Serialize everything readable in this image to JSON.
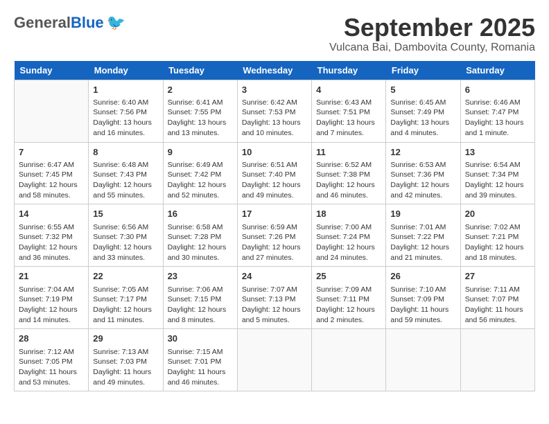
{
  "header": {
    "logo_general": "General",
    "logo_blue": "Blue",
    "month_year": "September 2025",
    "location": "Vulcana Bai, Dambovita County, Romania"
  },
  "days_of_week": [
    "Sunday",
    "Monday",
    "Tuesday",
    "Wednesday",
    "Thursday",
    "Friday",
    "Saturday"
  ],
  "weeks": [
    [
      {
        "day": "",
        "empty": true
      },
      {
        "day": "1",
        "sunrise": "6:40 AM",
        "sunset": "7:56 PM",
        "daylight": "13 hours and 16 minutes."
      },
      {
        "day": "2",
        "sunrise": "6:41 AM",
        "sunset": "7:55 PM",
        "daylight": "13 hours and 13 minutes."
      },
      {
        "day": "3",
        "sunrise": "6:42 AM",
        "sunset": "7:53 PM",
        "daylight": "13 hours and 10 minutes."
      },
      {
        "day": "4",
        "sunrise": "6:43 AM",
        "sunset": "7:51 PM",
        "daylight": "13 hours and 7 minutes."
      },
      {
        "day": "5",
        "sunrise": "6:45 AM",
        "sunset": "7:49 PM",
        "daylight": "13 hours and 4 minutes."
      },
      {
        "day": "6",
        "sunrise": "6:46 AM",
        "sunset": "7:47 PM",
        "daylight": "13 hours and 1 minute."
      }
    ],
    [
      {
        "day": "7",
        "sunrise": "6:47 AM",
        "sunset": "7:45 PM",
        "daylight": "12 hours and 58 minutes."
      },
      {
        "day": "8",
        "sunrise": "6:48 AM",
        "sunset": "7:43 PM",
        "daylight": "12 hours and 55 minutes."
      },
      {
        "day": "9",
        "sunrise": "6:49 AM",
        "sunset": "7:42 PM",
        "daylight": "12 hours and 52 minutes."
      },
      {
        "day": "10",
        "sunrise": "6:51 AM",
        "sunset": "7:40 PM",
        "daylight": "12 hours and 49 minutes."
      },
      {
        "day": "11",
        "sunrise": "6:52 AM",
        "sunset": "7:38 PM",
        "daylight": "12 hours and 46 minutes."
      },
      {
        "day": "12",
        "sunrise": "6:53 AM",
        "sunset": "7:36 PM",
        "daylight": "12 hours and 42 minutes."
      },
      {
        "day": "13",
        "sunrise": "6:54 AM",
        "sunset": "7:34 PM",
        "daylight": "12 hours and 39 minutes."
      }
    ],
    [
      {
        "day": "14",
        "sunrise": "6:55 AM",
        "sunset": "7:32 PM",
        "daylight": "12 hours and 36 minutes."
      },
      {
        "day": "15",
        "sunrise": "6:56 AM",
        "sunset": "7:30 PM",
        "daylight": "12 hours and 33 minutes."
      },
      {
        "day": "16",
        "sunrise": "6:58 AM",
        "sunset": "7:28 PM",
        "daylight": "12 hours and 30 minutes."
      },
      {
        "day": "17",
        "sunrise": "6:59 AM",
        "sunset": "7:26 PM",
        "daylight": "12 hours and 27 minutes."
      },
      {
        "day": "18",
        "sunrise": "7:00 AM",
        "sunset": "7:24 PM",
        "daylight": "12 hours and 24 minutes."
      },
      {
        "day": "19",
        "sunrise": "7:01 AM",
        "sunset": "7:22 PM",
        "daylight": "12 hours and 21 minutes."
      },
      {
        "day": "20",
        "sunrise": "7:02 AM",
        "sunset": "7:21 PM",
        "daylight": "12 hours and 18 minutes."
      }
    ],
    [
      {
        "day": "21",
        "sunrise": "7:04 AM",
        "sunset": "7:19 PM",
        "daylight": "12 hours and 14 minutes."
      },
      {
        "day": "22",
        "sunrise": "7:05 AM",
        "sunset": "7:17 PM",
        "daylight": "12 hours and 11 minutes."
      },
      {
        "day": "23",
        "sunrise": "7:06 AM",
        "sunset": "7:15 PM",
        "daylight": "12 hours and 8 minutes."
      },
      {
        "day": "24",
        "sunrise": "7:07 AM",
        "sunset": "7:13 PM",
        "daylight": "12 hours and 5 minutes."
      },
      {
        "day": "25",
        "sunrise": "7:09 AM",
        "sunset": "7:11 PM",
        "daylight": "12 hours and 2 minutes."
      },
      {
        "day": "26",
        "sunrise": "7:10 AM",
        "sunset": "7:09 PM",
        "daylight": "11 hours and 59 minutes."
      },
      {
        "day": "27",
        "sunrise": "7:11 AM",
        "sunset": "7:07 PM",
        "daylight": "11 hours and 56 minutes."
      }
    ],
    [
      {
        "day": "28",
        "sunrise": "7:12 AM",
        "sunset": "7:05 PM",
        "daylight": "11 hours and 53 minutes."
      },
      {
        "day": "29",
        "sunrise": "7:13 AM",
        "sunset": "7:03 PM",
        "daylight": "11 hours and 49 minutes."
      },
      {
        "day": "30",
        "sunrise": "7:15 AM",
        "sunset": "7:01 PM",
        "daylight": "11 hours and 46 minutes."
      },
      {
        "day": "",
        "empty": true
      },
      {
        "day": "",
        "empty": true
      },
      {
        "day": "",
        "empty": true
      },
      {
        "day": "",
        "empty": true
      }
    ]
  ]
}
